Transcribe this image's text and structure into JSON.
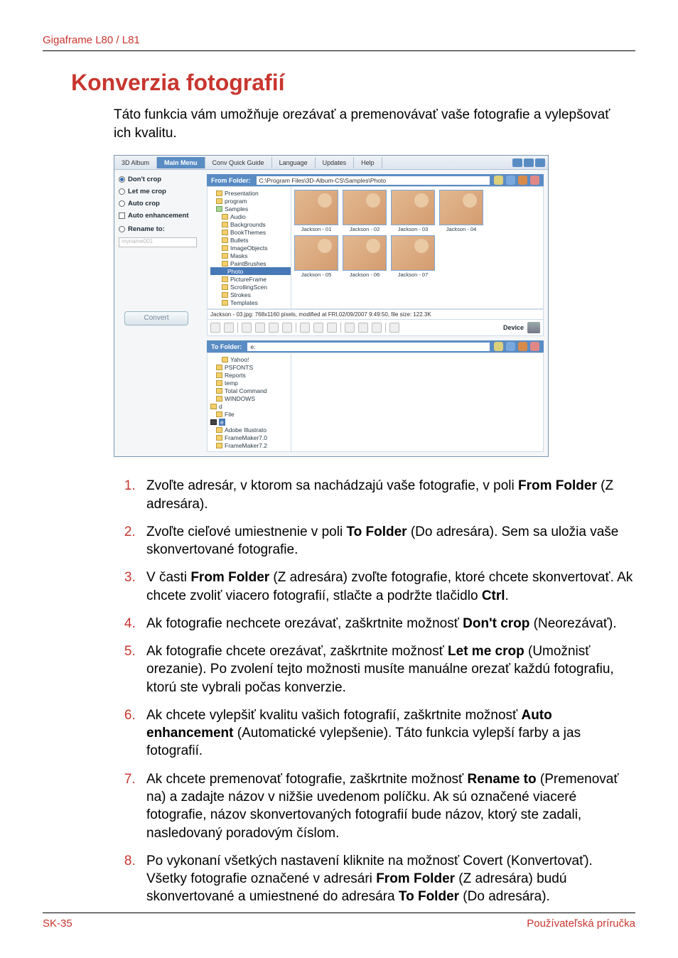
{
  "header": {
    "product": "Gigaframe L80 / L81"
  },
  "title": "Konverzia fotografií",
  "intro": "Táto funkcia vám umožňuje orezávať a premenovávať vaše fotografie a vylepšovať ich kvalitu.",
  "screenshot": {
    "app_label": "3D Album",
    "tabs": {
      "main": "Main Menu",
      "conv": "Conv Quick Guide",
      "language": "Language",
      "updates": "Updates",
      "help": "Help"
    },
    "left_panel": {
      "dont_crop": "Don't crop",
      "let_me_crop": "Let me crop",
      "auto_crop": "Auto crop",
      "auto_enhance": "Auto enhancement",
      "rename_to": "Rename to:",
      "rename_placeholder": "myname001",
      "convert_btn": "Convert"
    },
    "from": {
      "title": "From Folder:",
      "path": "C:\\Program Files\\3D-Album-CS\\Samples\\Photo",
      "tree": [
        "Presentation",
        "program",
        "Samples",
        "Audio",
        "Backgrounds",
        "BookThemes",
        "Bullets",
        "ImageObjects",
        "Masks",
        "PaintBrushes",
        "Photo",
        "PictureFrame",
        "ScrollingScen",
        "Strokes",
        "Templates"
      ],
      "thumbs_row1": [
        "Jackson - 01",
        "Jackson - 02",
        "Jackson - 03",
        "Jackson - 04"
      ],
      "thumbs_row2": [
        "Jackson - 05",
        "Jackson - 06",
        "Jackson - 07"
      ],
      "status": "Jackson - 03.jpg: 768x1160 pixels, modified at FRI,02/09/2007 9:49:50, file size: 122.3K",
      "device_label": "Device"
    },
    "to": {
      "title": "To Folder:",
      "path": "e:",
      "tree": [
        "Yahoo!",
        "PSFONTS",
        "Reports",
        "temp",
        "Total Command",
        "WINDOWS",
        "d",
        "File",
        "e",
        "Adobe Illustrato",
        "FrameMaker7.0",
        "FrameMaker7.2"
      ]
    }
  },
  "steps": {
    "s1a": "Zvoľte adresár, v ktorom sa nachádzajú vaše fotografie, v poli ",
    "s1b": "From Folder",
    "s1c": " (Z adresára).",
    "s2a": "Zvoľte cieľové umiestnenie v poli ",
    "s2b": "To Folder",
    "s2c": " (Do adresára). Sem sa uložia vaše skonvertované fotografie.",
    "s3a": "V časti ",
    "s3b": "From Folder",
    "s3c": " (Z adresára) zvoľte fotografie, ktoré chcete skonvertovať. Ak chcete zvoliť viacero fotografií, stlačte a podržte tlačidlo ",
    "s3d": "Ctrl",
    "s3e": ".",
    "s4a": "Ak fotografie nechcete orezávať, zaškrtnite možnosť ",
    "s4b": "Don't crop",
    "s4c": " (Neorezávať).",
    "s5a": "Ak fotografie chcete orezávať, zaškrtnite možnosť ",
    "s5b": "Let me crop",
    "s5c": " (Umožnisť orezanie). Po zvolení tejto možnosti musíte manuálne orezať každú fotografiu, ktorú ste vybrali počas konverzie.",
    "s6a": "Ak chcete vylepšiť kvalitu vašich fotografií, zaškrtnite možnosť ",
    "s6b": "Auto enhancement",
    "s6c": " (Automatické vylepšenie). Táto funkcia vylepší farby a jas fotografií.",
    "s7a": "Ak chcete premenovať fotografie, zaškrtnite možnosť ",
    "s7b": "Rename to",
    "s7c": " (Premenovať na) a zadajte názov v nižšie uvedenom políčku. Ak sú označené viaceré fotografie, názov skonvertovaných fotografií bude názov, ktorý ste zadali, nasledovaný poradovým číslom.",
    "s8a": "Po vykonaní všetkých nastavení kliknite na možnosť Covert (Konvertovať). Všetky fotografie označené v adresári ",
    "s8b": "From Folder",
    "s8c": " (Z adresára) budú skonvertované a umiestnené do adresára ",
    "s8d": "To Folder",
    "s8e": " (Do adresára)."
  },
  "footer": {
    "left": "SK-35",
    "right": "Používateľská príručka"
  }
}
